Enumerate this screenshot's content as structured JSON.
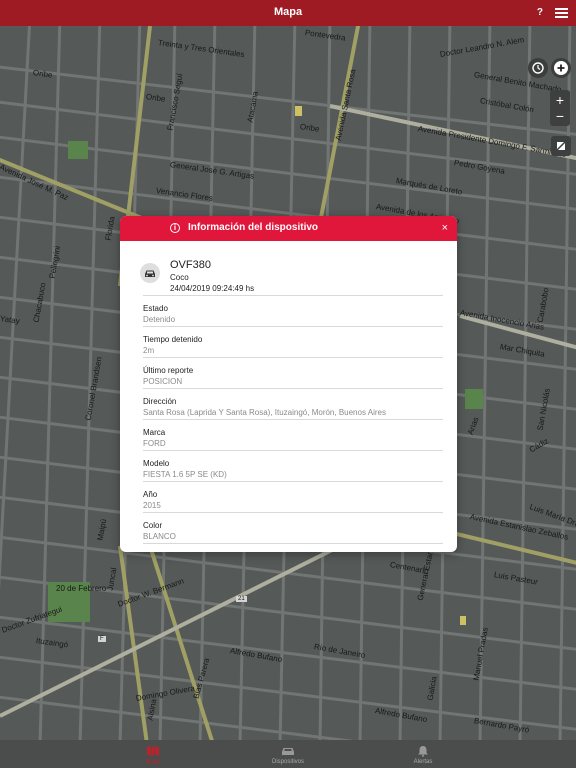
{
  "header": {
    "title": "Mapa",
    "help_label": "?"
  },
  "map": {
    "controls": {
      "zoom_in": "+",
      "zoom_out": "−"
    },
    "streets": [
      {
        "text": "Treinta y Tres Orientales"
      },
      {
        "text": "Pontevedra"
      },
      {
        "text": "Doctor Leandro N. Alem"
      },
      {
        "text": "General Benito Machado"
      },
      {
        "text": "Oribe"
      },
      {
        "text": "Oribe"
      },
      {
        "text": "Cristóbal Colón"
      },
      {
        "text": "Avenida Presidente Domingo F. Sarmiento"
      },
      {
        "text": "Avenida Santa Rosa"
      },
      {
        "text": "Atacama"
      },
      {
        "text": "General José G. Artigas"
      },
      {
        "text": "Pedro Goyena"
      },
      {
        "text": "Marqués de Loreto"
      },
      {
        "text": "Venancio Flores"
      },
      {
        "text": "Avenida José M. Paz"
      },
      {
        "text": "Avenida Inocencio Arias"
      },
      {
        "text": "Mar Chiquita"
      },
      {
        "text": "Avenida Estanislao Zeballos"
      },
      {
        "text": "Luis María Drago"
      },
      {
        "text": "Luis Pasteur"
      },
      {
        "text": "Centenario"
      },
      {
        "text": "Juncal"
      },
      {
        "text": "Doctor W. Bermann"
      },
      {
        "text": "Alfredo Bufano"
      },
      {
        "text": "Alfredo Bufano"
      },
      {
        "text": "Blas Parera"
      },
      {
        "text": "Río de Janeiro"
      },
      {
        "text": "Ituzaingó"
      },
      {
        "text": "Doctor Zufriategui"
      },
      {
        "text": "20 de Febrero"
      },
      {
        "text": "Yatay"
      },
      {
        "text": "General Estanislao López"
      },
      {
        "text": "Arias"
      },
      {
        "text": "Florida"
      },
      {
        "text": "Francisco Seguí"
      },
      {
        "text": "Cádiz"
      },
      {
        "text": "Pellegrini"
      },
      {
        "text": "Chacabuco"
      },
      {
        "text": "Maipú"
      },
      {
        "text": "Domingo Olivera"
      },
      {
        "text": "Bernardo Payró"
      },
      {
        "text": "Manuel Pradas"
      },
      {
        "text": "San Nicolás"
      },
      {
        "text": "Alsina"
      },
      {
        "text": "Coronel Brandsen"
      },
      {
        "text": "Galicia"
      },
      {
        "text": "Oribe"
      },
      {
        "text": "Carabobo"
      },
      {
        "text": "Avenida de los Arriendo"
      }
    ],
    "route_badges": [
      "F",
      "21"
    ]
  },
  "modal": {
    "title": "Información del dispositivo",
    "info_icon": "i",
    "close_label": "×",
    "device": {
      "plate": "OVF380",
      "owner": "Coco",
      "timestamp": "24/04/2019 09:24:49 hs"
    },
    "fields": [
      {
        "label": "Estado",
        "value": "Detenido"
      },
      {
        "label": "Tiempo detenido",
        "value": "2m"
      },
      {
        "label": "Último reporte",
        "value": "POSICION"
      },
      {
        "label": "Dirección",
        "value": "Santa Rosa (Laprida Y Santa Rosa), Ituzaingó, Morón, Buenos Aires"
      },
      {
        "label": "Marca",
        "value": "FORD"
      },
      {
        "label": "Modelo",
        "value": "FIESTA 1.6 5P SE (KD)"
      },
      {
        "label": "Año",
        "value": "2015"
      },
      {
        "label": "Color",
        "value": "BLANCO"
      }
    ]
  },
  "tabs": [
    {
      "label": "Mapa",
      "icon": "map-icon",
      "active": true
    },
    {
      "label": "Dispositivos",
      "icon": "car-icon",
      "active": false
    },
    {
      "label": "Alertas",
      "icon": "bell-icon",
      "active": false
    }
  ],
  "colors": {
    "header": "#9e1b24",
    "modal_header": "#e0163b",
    "map_background": "#595d5c",
    "active_tab": "#c0202a"
  }
}
